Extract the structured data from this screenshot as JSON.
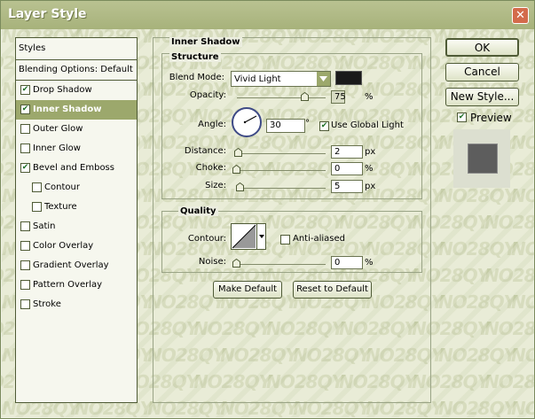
{
  "window": {
    "title": "Layer Style",
    "close_glyph": "✕",
    "watermark_text": "NO28QY"
  },
  "left_panel": {
    "styles_label": "Styles",
    "blending_label": "Blending Options: Default",
    "items": [
      {
        "label": "Drop Shadow",
        "checked": true
      },
      {
        "label": "Inner Shadow",
        "checked": true,
        "active": true
      },
      {
        "label": "Outer Glow",
        "checked": false
      },
      {
        "label": "Inner Glow",
        "checked": false
      },
      {
        "label": "Bevel and Emboss",
        "checked": true
      },
      {
        "label": "Contour",
        "checked": false,
        "indent": true
      },
      {
        "label": "Texture",
        "checked": false,
        "indent": true
      },
      {
        "label": "Satin",
        "checked": false
      },
      {
        "label": "Color Overlay",
        "checked": false
      },
      {
        "label": "Gradient Overlay",
        "checked": false
      },
      {
        "label": "Pattern Overlay",
        "checked": false
      },
      {
        "label": "Stroke",
        "checked": false
      }
    ],
    "check_glyph": "✔"
  },
  "inner_shadow": {
    "title": "Inner Shadow",
    "structure_title": "Structure",
    "blend_mode_label": "Blend Mode:",
    "blend_mode_value": "Vivid Light",
    "blend_color": "#1a1a1a",
    "opacity_label": "Opacity:",
    "opacity_value": "75",
    "opacity_unit": "%",
    "angle_label": "Angle:",
    "angle_value": "30",
    "angle_unit": "°",
    "use_global_light_label": "Use Global Light",
    "use_global_light_checked": true,
    "distance_label": "Distance:",
    "distance_value": "2",
    "distance_unit": "px",
    "choke_label": "Choke:",
    "choke_value": "0",
    "choke_unit": "%",
    "size_label": "Size:",
    "size_value": "5",
    "size_unit": "px"
  },
  "quality": {
    "title": "Quality",
    "contour_label": "Contour:",
    "anti_aliased_label": "Anti-aliased",
    "anti_aliased_checked": false,
    "noise_label": "Noise:",
    "noise_value": "0",
    "noise_unit": "%"
  },
  "buttons": {
    "make_default": "Make Default",
    "reset_to_default": "Reset to Default",
    "ok": "OK",
    "cancel": "Cancel",
    "new_style": "New Style...",
    "preview_label": "Preview",
    "preview_checked": true
  },
  "colors": {
    "accent": "#9ca86c",
    "titlebar": "#b1ba86",
    "close": "#d36b4b"
  }
}
